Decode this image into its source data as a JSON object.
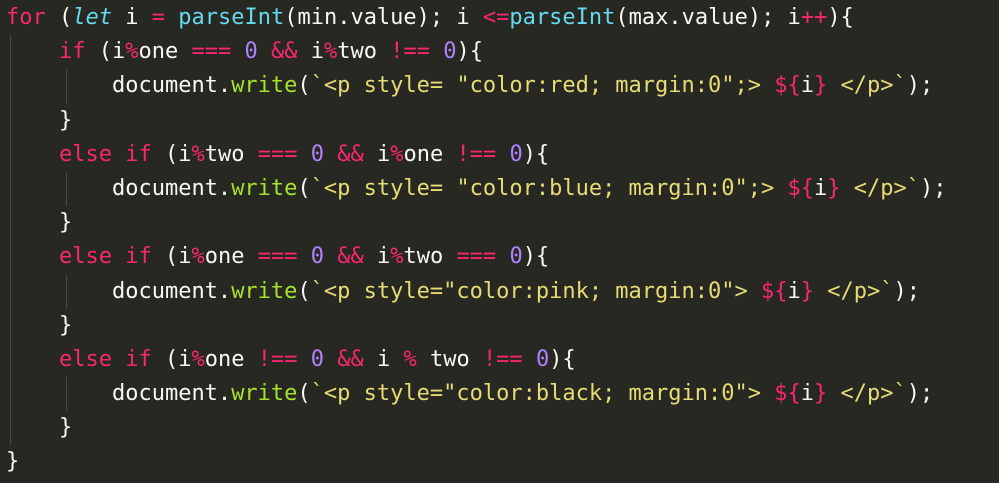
{
  "code_lines": [
    {
      "tokens": [
        {
          "t": "for",
          "c": "kw"
        },
        {
          "t": " (",
          "c": "plain"
        },
        {
          "t": "let",
          "c": "kwi"
        },
        {
          "t": " i ",
          "c": "plain"
        },
        {
          "t": "=",
          "c": "op"
        },
        {
          "t": " ",
          "c": "plain"
        },
        {
          "t": "parseInt",
          "c": "fn"
        },
        {
          "t": "(min.value); i ",
          "c": "plain"
        },
        {
          "t": "<=",
          "c": "op"
        },
        {
          "t": "parseInt",
          "c": "fn"
        },
        {
          "t": "(max.value); i",
          "c": "plain"
        },
        {
          "t": "++",
          "c": "op"
        },
        {
          "t": "){",
          "c": "plain"
        }
      ],
      "indent": 0
    },
    {
      "tokens": [
        {
          "t": "if",
          "c": "kw"
        },
        {
          "t": " (i",
          "c": "plain"
        },
        {
          "t": "%",
          "c": "op"
        },
        {
          "t": "one ",
          "c": "plain"
        },
        {
          "t": "===",
          "c": "op"
        },
        {
          "t": " ",
          "c": "plain"
        },
        {
          "t": "0",
          "c": "num"
        },
        {
          "t": " ",
          "c": "plain"
        },
        {
          "t": "&&",
          "c": "op"
        },
        {
          "t": " i",
          "c": "plain"
        },
        {
          "t": "%",
          "c": "op"
        },
        {
          "t": "two ",
          "c": "plain"
        },
        {
          "t": "!==",
          "c": "op"
        },
        {
          "t": " ",
          "c": "plain"
        },
        {
          "t": "0",
          "c": "num"
        },
        {
          "t": "){",
          "c": "plain"
        }
      ],
      "indent": 1
    },
    {
      "tokens": [
        {
          "t": "document.",
          "c": "plain"
        },
        {
          "t": "write",
          "c": "fnw"
        },
        {
          "t": "(",
          "c": "plain"
        },
        {
          "t": "`<p style= \"color:red; margin:0\";> ",
          "c": "str"
        },
        {
          "t": "${",
          "c": "tpl"
        },
        {
          "t": "i",
          "c": "plain"
        },
        {
          "t": "}",
          "c": "tpl"
        },
        {
          "t": " </p>`",
          "c": "str"
        },
        {
          "t": ");",
          "c": "plain"
        }
      ],
      "indent": 2
    },
    {
      "tokens": [
        {
          "t": "}",
          "c": "plain"
        }
      ],
      "indent": 1
    },
    {
      "tokens": [
        {
          "t": "else",
          "c": "kw"
        },
        {
          "t": " ",
          "c": "plain"
        },
        {
          "t": "if",
          "c": "kw"
        },
        {
          "t": " (i",
          "c": "plain"
        },
        {
          "t": "%",
          "c": "op"
        },
        {
          "t": "two ",
          "c": "plain"
        },
        {
          "t": "===",
          "c": "op"
        },
        {
          "t": " ",
          "c": "plain"
        },
        {
          "t": "0",
          "c": "num"
        },
        {
          "t": " ",
          "c": "plain"
        },
        {
          "t": "&&",
          "c": "op"
        },
        {
          "t": " i",
          "c": "plain"
        },
        {
          "t": "%",
          "c": "op"
        },
        {
          "t": "one ",
          "c": "plain"
        },
        {
          "t": "!==",
          "c": "op"
        },
        {
          "t": " ",
          "c": "plain"
        },
        {
          "t": "0",
          "c": "num"
        },
        {
          "t": "){",
          "c": "plain"
        }
      ],
      "indent": 1
    },
    {
      "tokens": [
        {
          "t": "document.",
          "c": "plain"
        },
        {
          "t": "write",
          "c": "fnw"
        },
        {
          "t": "(",
          "c": "plain"
        },
        {
          "t": "`<p style= \"color:blue; margin:0\";> ",
          "c": "str"
        },
        {
          "t": "${",
          "c": "tpl"
        },
        {
          "t": "i",
          "c": "plain"
        },
        {
          "t": "}",
          "c": "tpl"
        },
        {
          "t": " </p>`",
          "c": "str"
        },
        {
          "t": ");",
          "c": "plain"
        }
      ],
      "indent": 2
    },
    {
      "tokens": [
        {
          "t": "}",
          "c": "plain"
        }
      ],
      "indent": 1
    },
    {
      "tokens": [
        {
          "t": "else",
          "c": "kw"
        },
        {
          "t": " ",
          "c": "plain"
        },
        {
          "t": "if",
          "c": "kw"
        },
        {
          "t": " (i",
          "c": "plain"
        },
        {
          "t": "%",
          "c": "op"
        },
        {
          "t": "one ",
          "c": "plain"
        },
        {
          "t": "===",
          "c": "op"
        },
        {
          "t": " ",
          "c": "plain"
        },
        {
          "t": "0",
          "c": "num"
        },
        {
          "t": " ",
          "c": "plain"
        },
        {
          "t": "&&",
          "c": "op"
        },
        {
          "t": " i",
          "c": "plain"
        },
        {
          "t": "%",
          "c": "op"
        },
        {
          "t": "two ",
          "c": "plain"
        },
        {
          "t": "===",
          "c": "op"
        },
        {
          "t": " ",
          "c": "plain"
        },
        {
          "t": "0",
          "c": "num"
        },
        {
          "t": "){",
          "c": "plain"
        }
      ],
      "indent": 1
    },
    {
      "tokens": [
        {
          "t": "document.",
          "c": "plain"
        },
        {
          "t": "write",
          "c": "fnw"
        },
        {
          "t": "(",
          "c": "plain"
        },
        {
          "t": "`<p style=\"color:pink; margin:0\"> ",
          "c": "str"
        },
        {
          "t": "${",
          "c": "tpl"
        },
        {
          "t": "i",
          "c": "plain"
        },
        {
          "t": "}",
          "c": "tpl"
        },
        {
          "t": " </p>`",
          "c": "str"
        },
        {
          "t": ");",
          "c": "plain"
        }
      ],
      "indent": 2
    },
    {
      "tokens": [
        {
          "t": "}",
          "c": "plain"
        }
      ],
      "indent": 1
    },
    {
      "tokens": [
        {
          "t": "else",
          "c": "kw"
        },
        {
          "t": " ",
          "c": "plain"
        },
        {
          "t": "if",
          "c": "kw"
        },
        {
          "t": " (i",
          "c": "plain"
        },
        {
          "t": "%",
          "c": "op"
        },
        {
          "t": "one ",
          "c": "plain"
        },
        {
          "t": "!==",
          "c": "op"
        },
        {
          "t": " ",
          "c": "plain"
        },
        {
          "t": "0",
          "c": "num"
        },
        {
          "t": " ",
          "c": "plain"
        },
        {
          "t": "&&",
          "c": "op"
        },
        {
          "t": " i ",
          "c": "plain"
        },
        {
          "t": "%",
          "c": "op"
        },
        {
          "t": " two ",
          "c": "plain"
        },
        {
          "t": "!==",
          "c": "op"
        },
        {
          "t": " ",
          "c": "plain"
        },
        {
          "t": "0",
          "c": "num"
        },
        {
          "t": "){",
          "c": "plain"
        }
      ],
      "indent": 1
    },
    {
      "tokens": [
        {
          "t": "document.",
          "c": "plain"
        },
        {
          "t": "write",
          "c": "fnw"
        },
        {
          "t": "(",
          "c": "plain"
        },
        {
          "t": "`<p style=\"color:black; margin:0\"> ",
          "c": "str"
        },
        {
          "t": "${",
          "c": "tpl"
        },
        {
          "t": "i",
          "c": "plain"
        },
        {
          "t": "}",
          "c": "tpl"
        },
        {
          "t": " </p>`",
          "c": "str"
        },
        {
          "t": ");",
          "c": "plain"
        }
      ],
      "indent": 2
    },
    {
      "tokens": [
        {
          "t": "}",
          "c": "plain"
        }
      ],
      "indent": 1
    },
    {
      "tokens": [
        {
          "t": "}",
          "c": "plain"
        }
      ],
      "indent": 0
    }
  ],
  "theme": {
    "background": "#272822",
    "keyword": "#F92672",
    "function": "#66D9EF",
    "method": "#A6E22E",
    "number": "#AE81FF",
    "string": "#E6DB74",
    "text": "#F8F8F2"
  }
}
